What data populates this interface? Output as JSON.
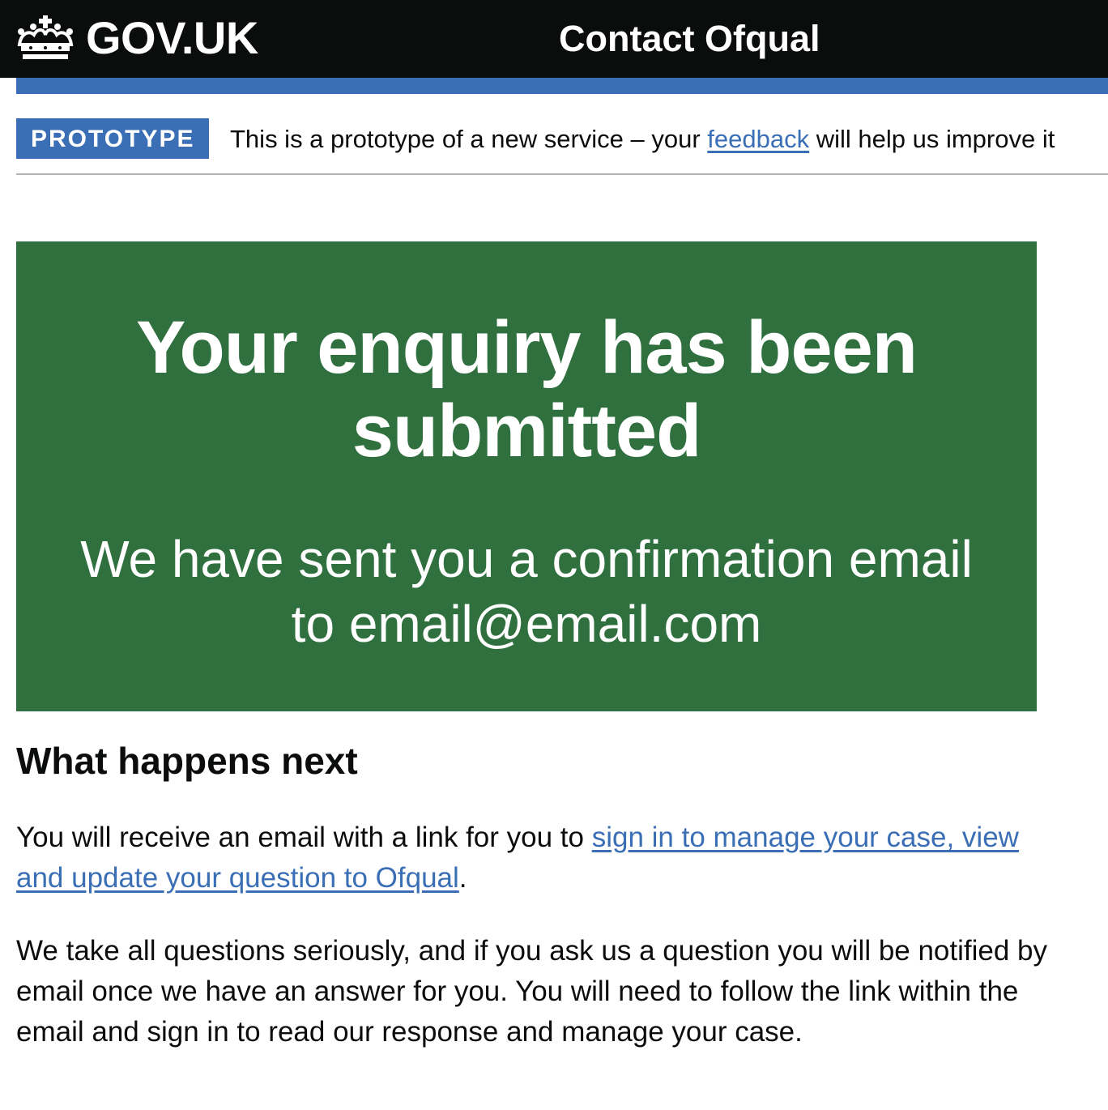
{
  "header": {
    "logo_text": "GOV.UK",
    "service_name": "Contact Ofqual"
  },
  "phase_banner": {
    "tag": "PROTOTYPE",
    "text_before": "This is a prototype of a new service – your ",
    "link_text": "feedback",
    "text_after": " will help us improve it"
  },
  "confirmation_panel": {
    "title": "Your enquiry has been submitted",
    "body": "We have sent you a confirmation email to email@email.com"
  },
  "next_steps": {
    "heading": "What happens next",
    "paragraph1_before": "You will receive an email with a link for you to ",
    "paragraph1_link": "sign in to manage your case, view and update your question to Ofqual",
    "paragraph1_after": ".",
    "paragraph2": "We take all questions seriously, and if you ask us a question you will be notified by email once we have an answer for you. You will need to follow the link within the email and sign in to read our response and manage your case."
  },
  "colors": {
    "header_bg": "#0b0c0c",
    "brand_blue": "#3a6eb5",
    "panel_green": "#30703f",
    "text": "#0b0c0c",
    "link": "#3a6eb5"
  }
}
